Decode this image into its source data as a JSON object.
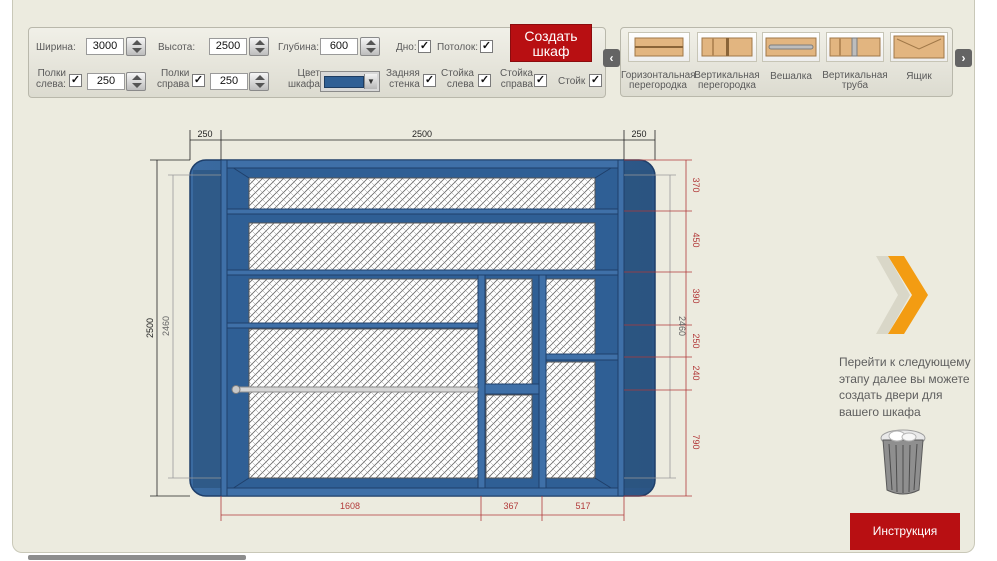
{
  "toolbar": {
    "width_label": "Ширина:",
    "width_value": "3000",
    "height_label": "Высота:",
    "height_value": "2500",
    "depth_label": "Глубина:",
    "depth_value": "600",
    "bottom_label": "Дно:",
    "ceiling_label": "Потолок:",
    "shelves_left_label_1": "Полки",
    "shelves_left_label_2": "слева:",
    "shelves_left_value": "250",
    "shelves_right_label_1": "Полки",
    "shelves_right_label_2": "справа",
    "shelves_right_value": "250",
    "color_label_1": "Цвет",
    "color_label_2": "шкафа",
    "back_wall_label_1": "Задняя",
    "back_wall_label_2": "стенка",
    "post_left_label_1": "Стойка",
    "post_left_label_2": "слева",
    "post_right_label_1": "Стойка",
    "post_right_label_2": "справа",
    "post_label": "Стойк",
    "check_mark": "✓",
    "create_label_1": "Создать",
    "create_label_2": "шкаф",
    "cabinet_color": "#2f5f95"
  },
  "parts": {
    "prev": "‹",
    "next": "›",
    "items": [
      {
        "label_1": "Горизонтальная",
        "label_2": "перегородка",
        "icon": "horizontal-partition-icon"
      },
      {
        "label_1": "Вертикальная",
        "label_2": "перегородка",
        "icon": "vertical-partition-icon"
      },
      {
        "label_1": "Вешалка",
        "label_2": "",
        "icon": "hanger-rail-icon"
      },
      {
        "label_1": "Вертикальная",
        "label_2": "труба",
        "icon": "vertical-pipe-icon"
      },
      {
        "label_1": "Ящик",
        "label_2": "",
        "icon": "drawer-icon"
      }
    ]
  },
  "dims": {
    "top_left": "250",
    "top_center": "2500",
    "top_right": "250",
    "left_outer": "2500",
    "left_inner": "2460",
    "right_inner": "2460",
    "right": [
      "370",
      "450",
      "390",
      "250",
      "240",
      "790"
    ],
    "bottom": [
      "1608",
      "367",
      "517"
    ]
  },
  "sidebar": {
    "next_text": "Перейти к следующему этапу далее вы можете создать двери для вашего шкафа",
    "instruction": "Инструкция"
  }
}
